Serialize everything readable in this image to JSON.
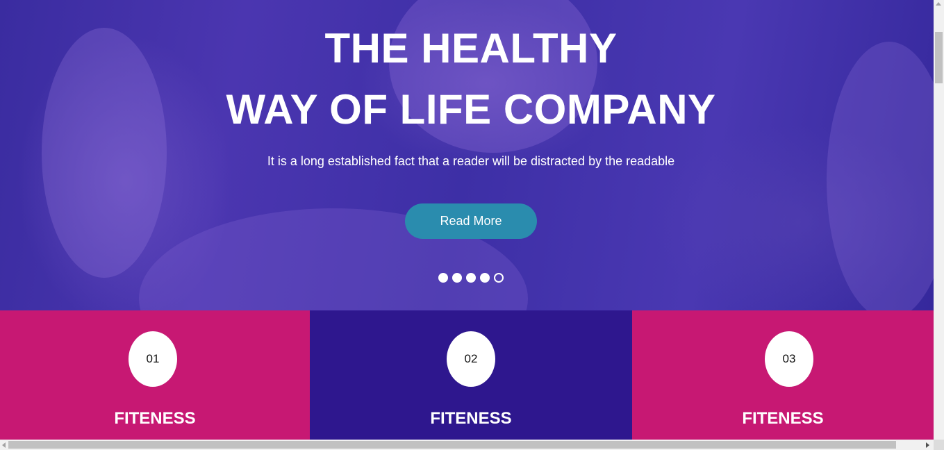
{
  "hero": {
    "title_line1": "THE HEALTHY",
    "title_line2": "WAY OF LIFE COMPANY",
    "subtitle": "It is a long established fact that a reader will be distracted by the readable",
    "button_label": "Read More",
    "slider": {
      "total_slides": 5,
      "active_index": 4
    },
    "colors": {
      "overlay": "#3d2fa6",
      "button": "#2a8cae"
    }
  },
  "features": [
    {
      "number": "01",
      "title": "FITENESS",
      "color": "#c71873"
    },
    {
      "number": "02",
      "title": "FITENESS",
      "color": "#2e178e"
    },
    {
      "number": "03",
      "title": "FITENESS",
      "color": "#c71873"
    }
  ]
}
